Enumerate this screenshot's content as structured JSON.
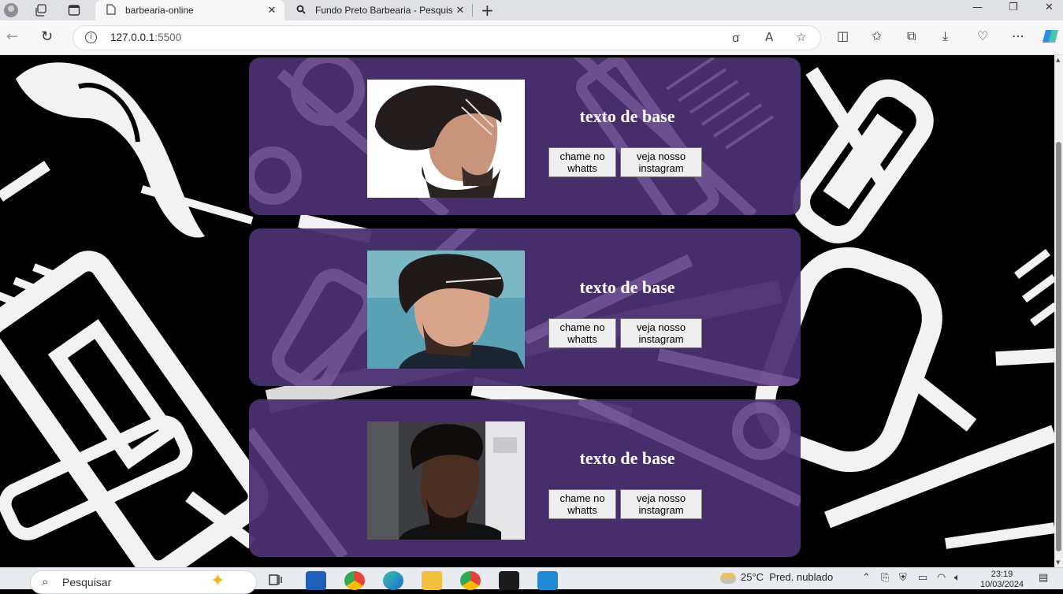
{
  "browser": {
    "tabs": [
      {
        "title": "barbearia-online",
        "active": true
      },
      {
        "title": "Fundo Preto Barbearia - Pesquisar",
        "active": false
      }
    ],
    "address": {
      "host": "127.0.0.1",
      "port": ":5500"
    }
  },
  "cards": [
    {
      "heading": "texto de base",
      "whatts_label": "chame no whatts",
      "instagram_label": "veja nosso instagram"
    },
    {
      "heading": "texto de base",
      "whatts_label": "chame no whatts",
      "instagram_label": "veja nosso instagram"
    },
    {
      "heading": "texto de base",
      "whatts_label": "chame no whatts",
      "instagram_label": "veja nosso instagram"
    }
  ],
  "taskbar": {
    "search_placeholder": "Pesquisar",
    "weather_temp": "25°C",
    "weather_text": "Pred. nublado",
    "time": "23:19",
    "date": "10/03/2024"
  },
  "colors": {
    "card": "#4a3070",
    "page_bg": "#000000",
    "button_bg": "#efefef"
  },
  "icons": [
    "profile-icon",
    "workspaces-icon",
    "tab-actions-icon",
    "page-icon",
    "search-icon",
    "close-icon",
    "new-tab-icon",
    "back-icon",
    "reload-icon",
    "info-icon",
    "translate-icon",
    "read-aloud-icon",
    "favorite-icon",
    "split-screen-icon",
    "favorites-icon",
    "collections-icon",
    "downloads-icon",
    "browser-essentials-icon",
    "more-icon",
    "copilot-icon"
  ]
}
